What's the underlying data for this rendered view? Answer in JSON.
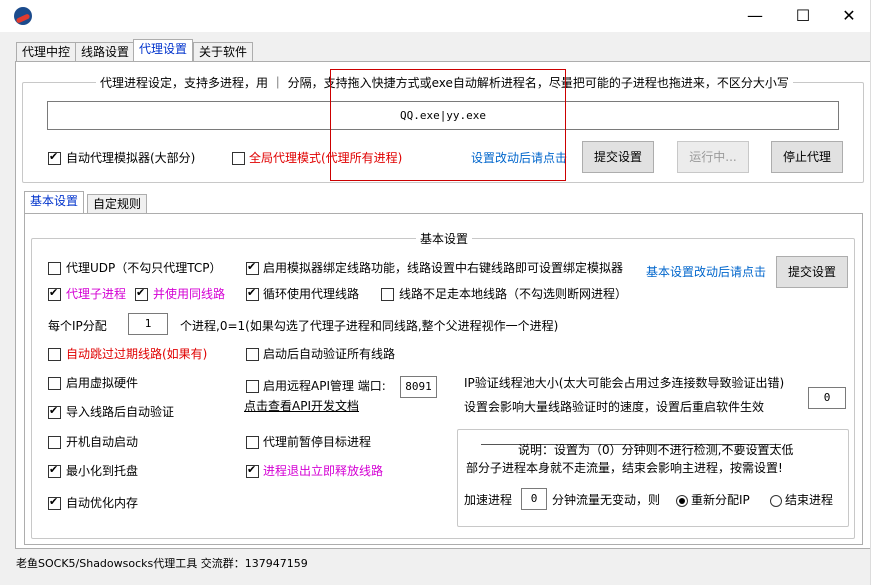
{
  "window": {
    "minimize_glyph": "—",
    "maximize_glyph": "☐",
    "close_glyph": "✕"
  },
  "tabs": [
    "代理中控",
    "线路设置",
    "代理设置",
    "关于软件"
  ],
  "proxy_process": {
    "group_title": "代理进程设定，支持多进程，用 ｜ 分隔，支持拖入快捷方式或exe自动解析进程名，尽量把可能的子进程也拖进来，不区分大小写",
    "process_value": "QQ.exe|yy.exe",
    "auto_proxy_emulator_label": "自动代理模拟器(大部分)",
    "auto_proxy_emulator_checked": true,
    "global_proxy_label": "全局代理模式(代理所有进程)",
    "global_proxy_checked": false,
    "hint_link": "设置改动后请点击",
    "submit_button": "提交设置",
    "running_button": "运行中...",
    "stop_button": "停止代理"
  },
  "subtabs": [
    "基本设置",
    "自定规则"
  ],
  "basic": {
    "group_title": "基本设置",
    "proxy_udp": "代理UDP（不勾只代理TCP）",
    "proxy_udp_checked": false,
    "bind_emulator": "启用模拟器绑定线路功能，线路设置中右键线路即可设置绑定模拟器",
    "bind_emulator_checked": true,
    "hint_link": "基本设置改动后请点击",
    "submit_button": "提交设置",
    "proxy_child": "代理子进程",
    "proxy_child_checked": true,
    "same_line": "并使用同线路",
    "same_line_checked": true,
    "loop_lines": "循环使用代理线路",
    "loop_lines_checked": true,
    "lines_not_enough": "线路不足走本地线路（不勾选则断网进程）",
    "lines_not_enough_checked": false,
    "per_ip_label": "每个IP分配",
    "per_ip_value": "1",
    "per_ip_desc": "个进程,0=1(如果勾选了代理子进程和同线路,整个父进程视作一个进程)",
    "auto_skip_expired": "自动跳过过期线路(如果有)",
    "auto_skip_expired_checked": false,
    "auto_verify_after_start": "启动后自动验证所有线路",
    "auto_verify_after_start_checked": false,
    "virtual_hw": "启用虚拟硬件",
    "virtual_hw_checked": false,
    "remote_api": "启用远程API管理 端口:",
    "remote_api_checked": false,
    "port_value": "8091",
    "api_doc_link": "点击查看API开发文档",
    "ip_pool_label": "IP验证线程池大小(太大可能会占用过多连接数导致验证出错)",
    "ip_pool_desc": "设置会影响大量线路验证时的速度，设置后重启软件生效",
    "ip_pool_value": "0",
    "auto_verify_import": "导入线路后自动验证",
    "auto_verify_import_checked": true,
    "autostart": "开机自动启动",
    "autostart_checked": false,
    "pause_target": "代理前暂停目标进程",
    "pause_target_checked": false,
    "minimize_tray": "最小化到托盘",
    "minimize_tray_checked": true,
    "release_on_exit": "进程退出立即释放线路",
    "release_on_exit_checked": true,
    "auto_optimize_mem": "自动优化内存",
    "auto_optimize_mem_checked": true,
    "note_line1": "说明：设置为（0）分钟则不进行检测,不要设置太低",
    "note_line2": "部分子进程本身就不走流量，结束会影响主进程，按需设置!",
    "accel_label": "加速进程",
    "accel_value": "0",
    "accel_desc": "分钟流量无变动，则",
    "realloc_ip": "重新分配IP",
    "realloc_ip_selected": true,
    "end_process": "结束进程",
    "end_process_selected": false
  },
  "status_bar": "老鱼SOCK5/Shadowsocks代理工具 交流群：137947159",
  "colors": {
    "red_text": "#e00000",
    "magenta_text": "#d400d4",
    "link_blue": "#0066cc",
    "highlight_box": "#cc0000"
  }
}
